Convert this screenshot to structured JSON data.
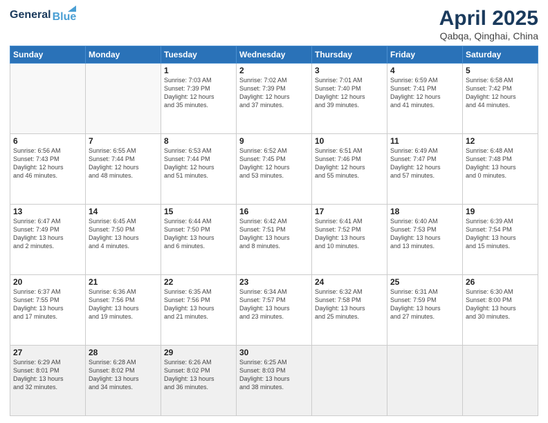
{
  "header": {
    "logo_general": "General",
    "logo_blue": "Blue",
    "title": "April 2025",
    "subtitle": "Qabqa, Qinghai, China"
  },
  "days_of_week": [
    "Sunday",
    "Monday",
    "Tuesday",
    "Wednesday",
    "Thursday",
    "Friday",
    "Saturday"
  ],
  "weeks": [
    [
      {
        "day": "",
        "info": ""
      },
      {
        "day": "",
        "info": ""
      },
      {
        "day": "1",
        "info": "Sunrise: 7:03 AM\nSunset: 7:39 PM\nDaylight: 12 hours\nand 35 minutes."
      },
      {
        "day": "2",
        "info": "Sunrise: 7:02 AM\nSunset: 7:39 PM\nDaylight: 12 hours\nand 37 minutes."
      },
      {
        "day": "3",
        "info": "Sunrise: 7:01 AM\nSunset: 7:40 PM\nDaylight: 12 hours\nand 39 minutes."
      },
      {
        "day": "4",
        "info": "Sunrise: 6:59 AM\nSunset: 7:41 PM\nDaylight: 12 hours\nand 41 minutes."
      },
      {
        "day": "5",
        "info": "Sunrise: 6:58 AM\nSunset: 7:42 PM\nDaylight: 12 hours\nand 44 minutes."
      }
    ],
    [
      {
        "day": "6",
        "info": "Sunrise: 6:56 AM\nSunset: 7:43 PM\nDaylight: 12 hours\nand 46 minutes."
      },
      {
        "day": "7",
        "info": "Sunrise: 6:55 AM\nSunset: 7:44 PM\nDaylight: 12 hours\nand 48 minutes."
      },
      {
        "day": "8",
        "info": "Sunrise: 6:53 AM\nSunset: 7:44 PM\nDaylight: 12 hours\nand 51 minutes."
      },
      {
        "day": "9",
        "info": "Sunrise: 6:52 AM\nSunset: 7:45 PM\nDaylight: 12 hours\nand 53 minutes."
      },
      {
        "day": "10",
        "info": "Sunrise: 6:51 AM\nSunset: 7:46 PM\nDaylight: 12 hours\nand 55 minutes."
      },
      {
        "day": "11",
        "info": "Sunrise: 6:49 AM\nSunset: 7:47 PM\nDaylight: 12 hours\nand 57 minutes."
      },
      {
        "day": "12",
        "info": "Sunrise: 6:48 AM\nSunset: 7:48 PM\nDaylight: 13 hours\nand 0 minutes."
      }
    ],
    [
      {
        "day": "13",
        "info": "Sunrise: 6:47 AM\nSunset: 7:49 PM\nDaylight: 13 hours\nand 2 minutes."
      },
      {
        "day": "14",
        "info": "Sunrise: 6:45 AM\nSunset: 7:50 PM\nDaylight: 13 hours\nand 4 minutes."
      },
      {
        "day": "15",
        "info": "Sunrise: 6:44 AM\nSunset: 7:50 PM\nDaylight: 13 hours\nand 6 minutes."
      },
      {
        "day": "16",
        "info": "Sunrise: 6:42 AM\nSunset: 7:51 PM\nDaylight: 13 hours\nand 8 minutes."
      },
      {
        "day": "17",
        "info": "Sunrise: 6:41 AM\nSunset: 7:52 PM\nDaylight: 13 hours\nand 10 minutes."
      },
      {
        "day": "18",
        "info": "Sunrise: 6:40 AM\nSunset: 7:53 PM\nDaylight: 13 hours\nand 13 minutes."
      },
      {
        "day": "19",
        "info": "Sunrise: 6:39 AM\nSunset: 7:54 PM\nDaylight: 13 hours\nand 15 minutes."
      }
    ],
    [
      {
        "day": "20",
        "info": "Sunrise: 6:37 AM\nSunset: 7:55 PM\nDaylight: 13 hours\nand 17 minutes."
      },
      {
        "day": "21",
        "info": "Sunrise: 6:36 AM\nSunset: 7:56 PM\nDaylight: 13 hours\nand 19 minutes."
      },
      {
        "day": "22",
        "info": "Sunrise: 6:35 AM\nSunset: 7:56 PM\nDaylight: 13 hours\nand 21 minutes."
      },
      {
        "day": "23",
        "info": "Sunrise: 6:34 AM\nSunset: 7:57 PM\nDaylight: 13 hours\nand 23 minutes."
      },
      {
        "day": "24",
        "info": "Sunrise: 6:32 AM\nSunset: 7:58 PM\nDaylight: 13 hours\nand 25 minutes."
      },
      {
        "day": "25",
        "info": "Sunrise: 6:31 AM\nSunset: 7:59 PM\nDaylight: 13 hours\nand 27 minutes."
      },
      {
        "day": "26",
        "info": "Sunrise: 6:30 AM\nSunset: 8:00 PM\nDaylight: 13 hours\nand 30 minutes."
      }
    ],
    [
      {
        "day": "27",
        "info": "Sunrise: 6:29 AM\nSunset: 8:01 PM\nDaylight: 13 hours\nand 32 minutes."
      },
      {
        "day": "28",
        "info": "Sunrise: 6:28 AM\nSunset: 8:02 PM\nDaylight: 13 hours\nand 34 minutes."
      },
      {
        "day": "29",
        "info": "Sunrise: 6:26 AM\nSunset: 8:02 PM\nDaylight: 13 hours\nand 36 minutes."
      },
      {
        "day": "30",
        "info": "Sunrise: 6:25 AM\nSunset: 8:03 PM\nDaylight: 13 hours\nand 38 minutes."
      },
      {
        "day": "",
        "info": ""
      },
      {
        "day": "",
        "info": ""
      },
      {
        "day": "",
        "info": ""
      }
    ]
  ]
}
